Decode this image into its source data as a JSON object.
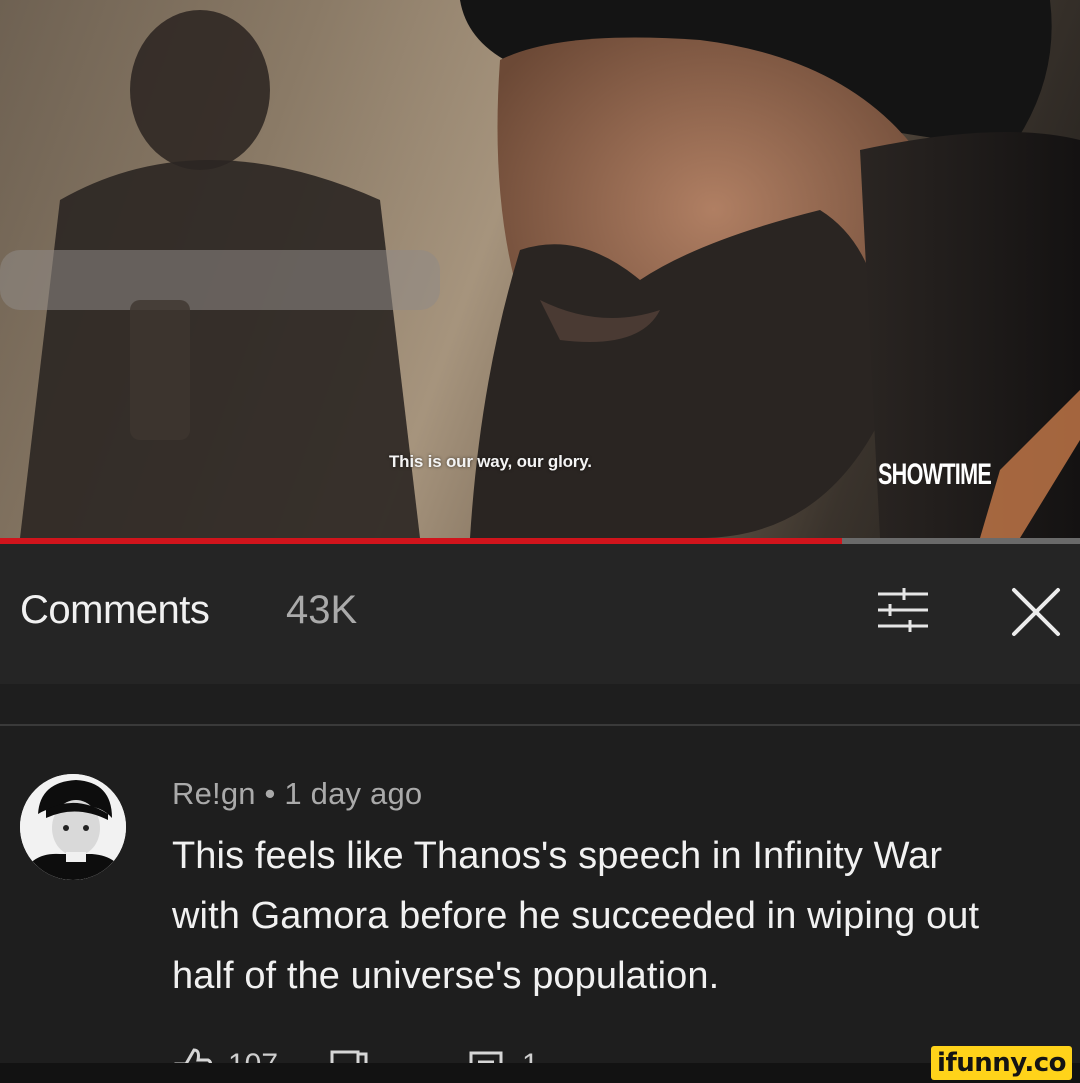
{
  "video": {
    "subtitle": "This is our way, our glory.",
    "network_watermark": "SHOWTIME",
    "progress_fraction": 0.78,
    "progress_color": "#d0141c"
  },
  "comments_header": {
    "title": "Comments",
    "count": "43K",
    "sort_icon": "sort-filter-icon",
    "close_icon": "close-icon"
  },
  "comment": {
    "author": "Re!gn",
    "separator": "•",
    "time_ago": "1 day ago",
    "meta_text": "Re!gn • 1 day ago",
    "body_lines": [
      "This feels like Thanos's speech in Infinity War",
      "with Gamora before he succeeded in wiping out",
      "half of the universe's population."
    ],
    "likes": "107",
    "replies": "1"
  },
  "site_watermark": "ifunny.co",
  "colors": {
    "background": "#1e1e1e",
    "header_background": "#252525",
    "text_primary": "#f1f1f1",
    "text_secondary": "#aaaaaa",
    "watermark_bg": "#ffd31a"
  }
}
